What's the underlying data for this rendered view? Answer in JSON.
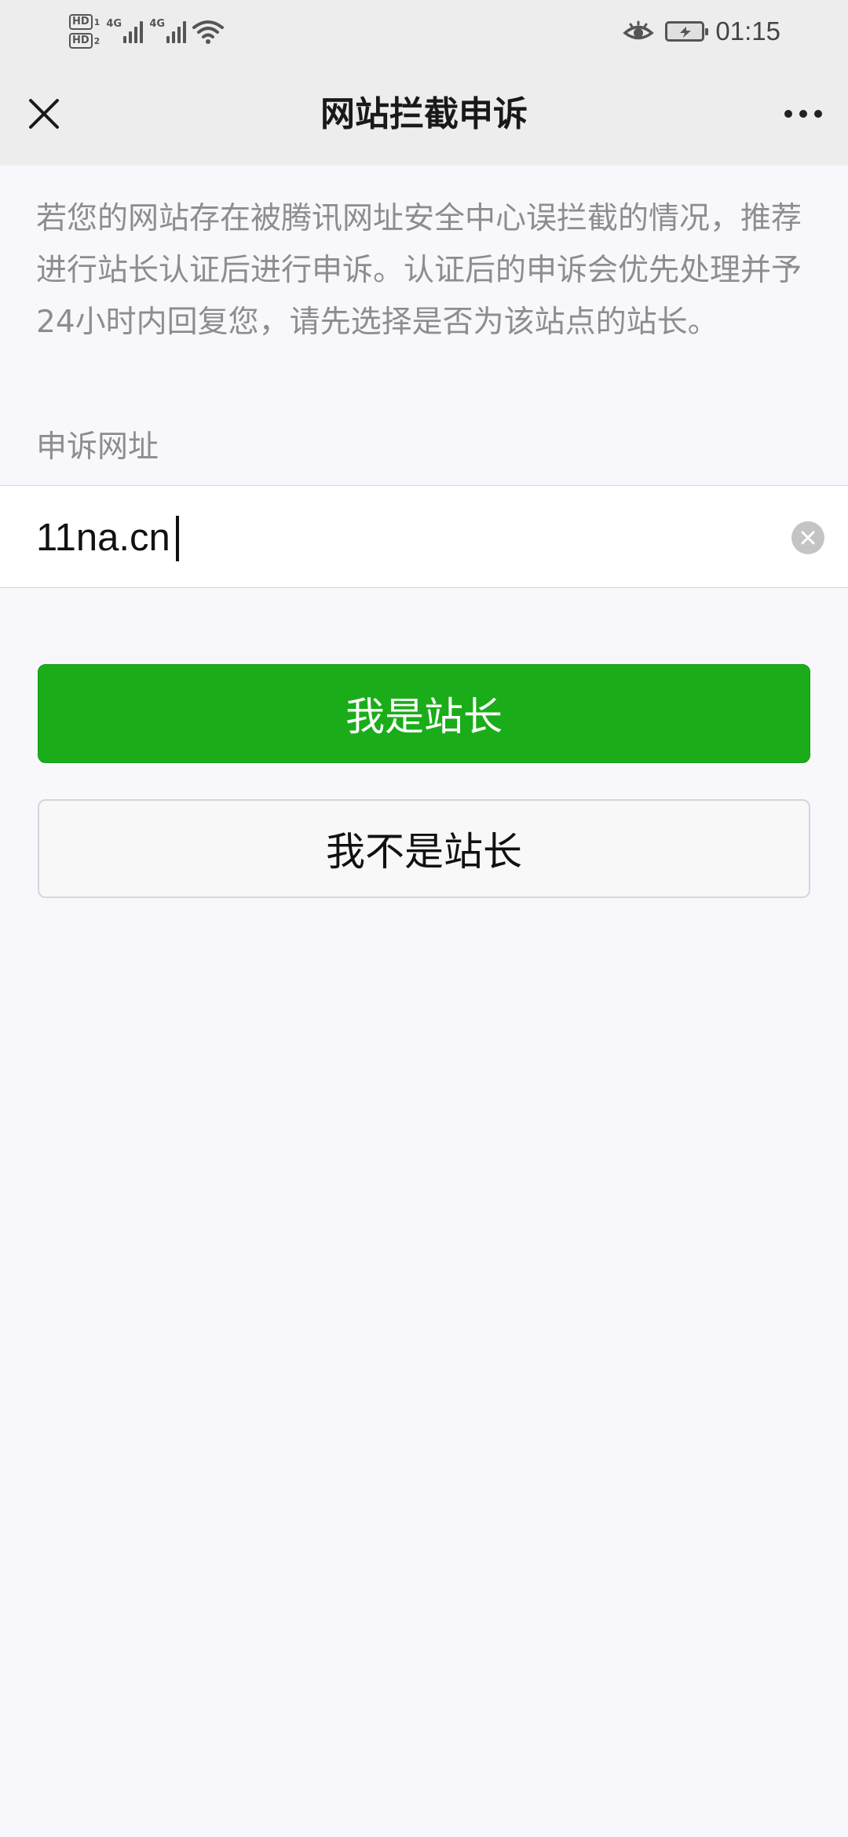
{
  "status_bar": {
    "sim1_label": "HD",
    "sim1_index": "1",
    "sim2_label": "HD",
    "sim2_index": "2",
    "network1": "4G",
    "network2": "4G",
    "time": "01:15",
    "icons": [
      "signal-icon",
      "wifi-icon",
      "eye-icon",
      "battery-icon"
    ]
  },
  "nav": {
    "title": "网站拦截申诉",
    "close_icon": "close-icon",
    "more_icon": "more-icon"
  },
  "intro_text": "若您的网站存在被腾讯网址安全中心误拦截的情况，推荐进行站长认证后进行申诉。认证后的申诉会优先处理并予24小时内回复您，请先选择是否为该站点的站长。",
  "url_section": {
    "label": "申诉网址",
    "value": "11na.cn",
    "clear_icon": "clear-icon"
  },
  "buttons": {
    "is_owner": "我是站长",
    "not_owner": "我不是站长"
  },
  "colors": {
    "primary_green": "#1aad19",
    "nav_background": "#ededed",
    "page_background": "#f8f7fc",
    "muted_text": "#8d8d8d"
  }
}
